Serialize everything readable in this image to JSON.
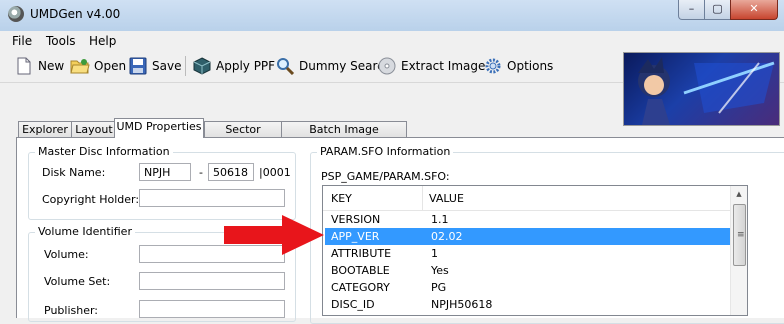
{
  "window": {
    "title": "UMDGen v4.00",
    "min": "–",
    "max": "▢",
    "close": "✕"
  },
  "menu": [
    "File",
    "Tools",
    "Help"
  ],
  "toolbar": {
    "new": "New",
    "open": "Open",
    "save": "Save",
    "apply_ppf": "Apply PPF",
    "dummy_search": "Dummy Search",
    "extract_image": "Extract Image",
    "options": "Options"
  },
  "tabs": [
    "Explorer",
    "Layout",
    "UMD Properties",
    "Sector Viewer",
    "Batch Image Converter"
  ],
  "active_tab": "UMD Properties",
  "master_disc": {
    "group_title": "Master Disc Information",
    "disk_name_label": "Disk Name:",
    "disk_prefix": "NPJH",
    "dash": "-",
    "disk_number": "50618",
    "disk_suffix": "|0001",
    "copyright_label": "Copyright Holder:",
    "copyright_value": ""
  },
  "volume": {
    "group_title": "Volume Identifier",
    "volume_label": "Volume:",
    "volume_set_label": "Volume Set:",
    "publisher_label": "Publisher:"
  },
  "param_sfo": {
    "group_title": "PARAM.SFO Information",
    "path": "PSP_GAME/PARAM.SFO:",
    "columns": {
      "key": "KEY",
      "value": "VALUE"
    },
    "rows": [
      {
        "key": "VERSION",
        "value": "1.1"
      },
      {
        "key": "APP_VER",
        "value": "02.02"
      },
      {
        "key": "ATTRIBUTE",
        "value": "1"
      },
      {
        "key": "BOOTABLE",
        "value": "Yes"
      },
      {
        "key": "CATEGORY",
        "value": "PG"
      },
      {
        "key": "DISC_ID",
        "value": "NPJH50618"
      }
    ],
    "selected_row": 1
  },
  "colors": {
    "selection": "#3399ff",
    "annotation_arrow": "#e8151b"
  }
}
